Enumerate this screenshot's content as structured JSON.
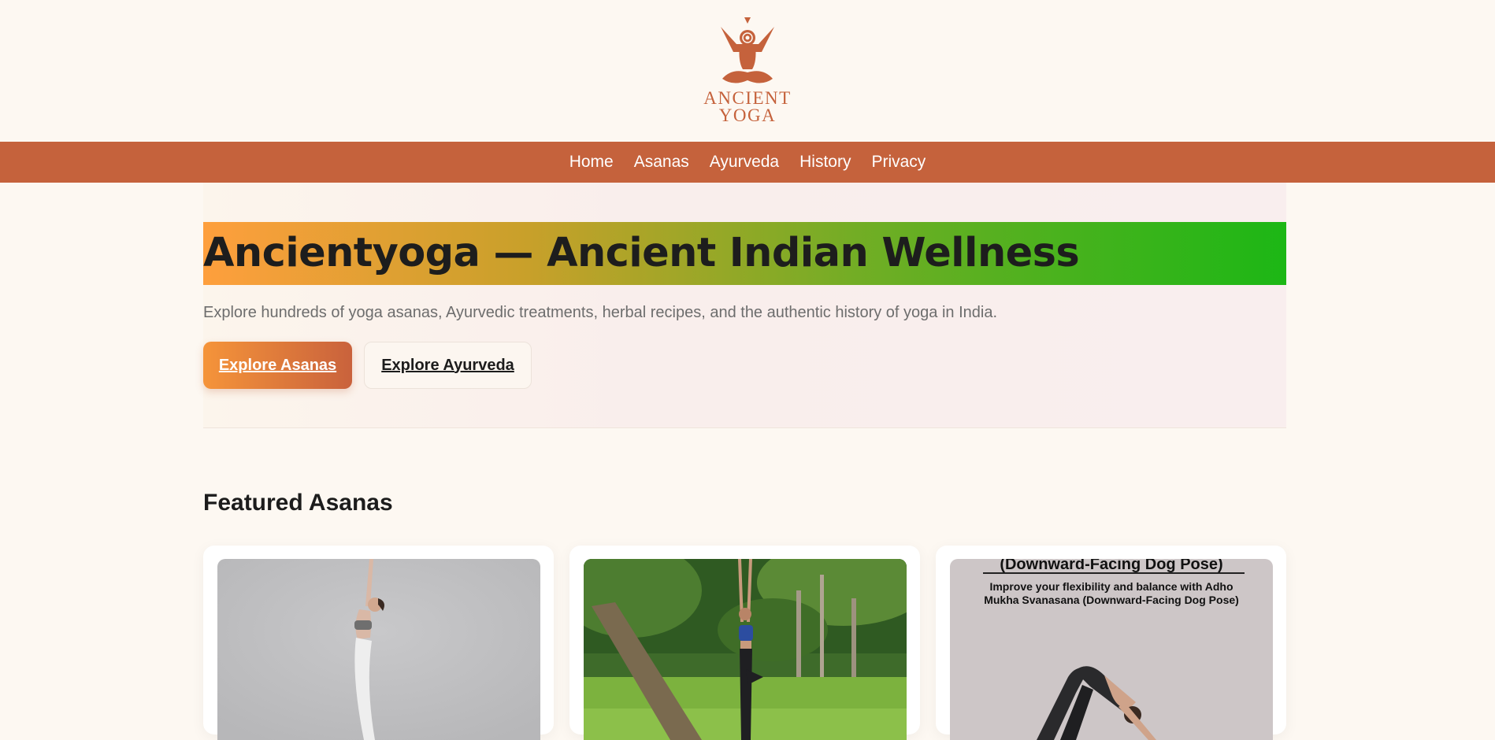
{
  "logo": {
    "line1": "ANCIENT",
    "line2": "YOGA",
    "icon": "meditating-figure-icon"
  },
  "nav": [
    {
      "label": "Home"
    },
    {
      "label": "Asanas"
    },
    {
      "label": "Ayurveda"
    },
    {
      "label": "History"
    },
    {
      "label": "Privacy"
    }
  ],
  "hero": {
    "title": "Ancientyoga — Ancient Indian Wellness",
    "subtitle": "Explore hundreds of yoga asanas, Ayurvedic treatments, herbal recipes, and the authentic history of yoga in India.",
    "primary_button": "Explore Asanas",
    "secondary_button": "Explore Ayurveda"
  },
  "featured": {
    "title": "Featured Asanas",
    "cards": [
      {
        "image": "standing-backbend-photo"
      },
      {
        "image": "tree-pose-outdoor-photo"
      },
      {
        "image": "downward-dog-poster",
        "poster_heading": "(Downward-Facing Dog Pose)",
        "poster_text": "Improve your flexibility and balance with Adho Mukha Svanasana (Downward-Facing Dog Pose)"
      }
    ]
  },
  "colors": {
    "brand": "#c5623c",
    "background": "#fdf8f2",
    "accent_orange": "#f5943a",
    "accent_green": "#1cb715"
  }
}
